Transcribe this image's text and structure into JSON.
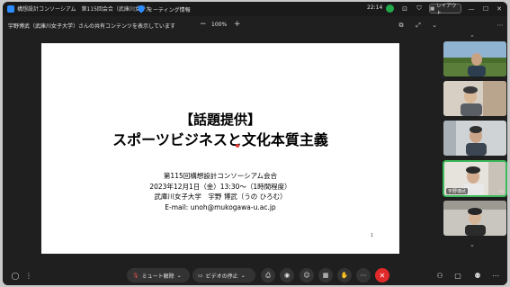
{
  "window": {
    "title": "構想設計コンソーシアム　第115回会合（武庫川女子大",
    "meeting_info_label": "ミーティング情報",
    "time": "22:14",
    "layout_label": "レイアウト"
  },
  "share": {
    "banner": "宇野博武（武庫川女子大学）さんの共有コンテンツを表示しています",
    "zoom_minus": "−",
    "zoom_level": "100%",
    "zoom_plus": "+"
  },
  "slide": {
    "title_line1": "【話題提供】",
    "title_line2": "スポーツビジネスと文化本質主義",
    "lines": [
      "第115回構想設計コンソーシアム会合",
      "2023年12月1日（金）13:30〜（1時間程度）",
      "武庫川女子大学　宇野 博武（うの ひろむ）",
      "E-mail: unoh@mukogawa-u.ac.jp"
    ],
    "page_number": "1"
  },
  "participants": [
    {
      "name": ""
    },
    {
      "name": ""
    },
    {
      "name": ""
    },
    {
      "name": "宇野博武"
    },
    {
      "name": ""
    }
  ],
  "toolbar": {
    "mute_label": "ミュート解除",
    "video_label": "ビデオの停止"
  },
  "colors": {
    "leave": "#e02a2a",
    "active_speaker": "#3dba5c",
    "brand": "#2d8cff"
  }
}
